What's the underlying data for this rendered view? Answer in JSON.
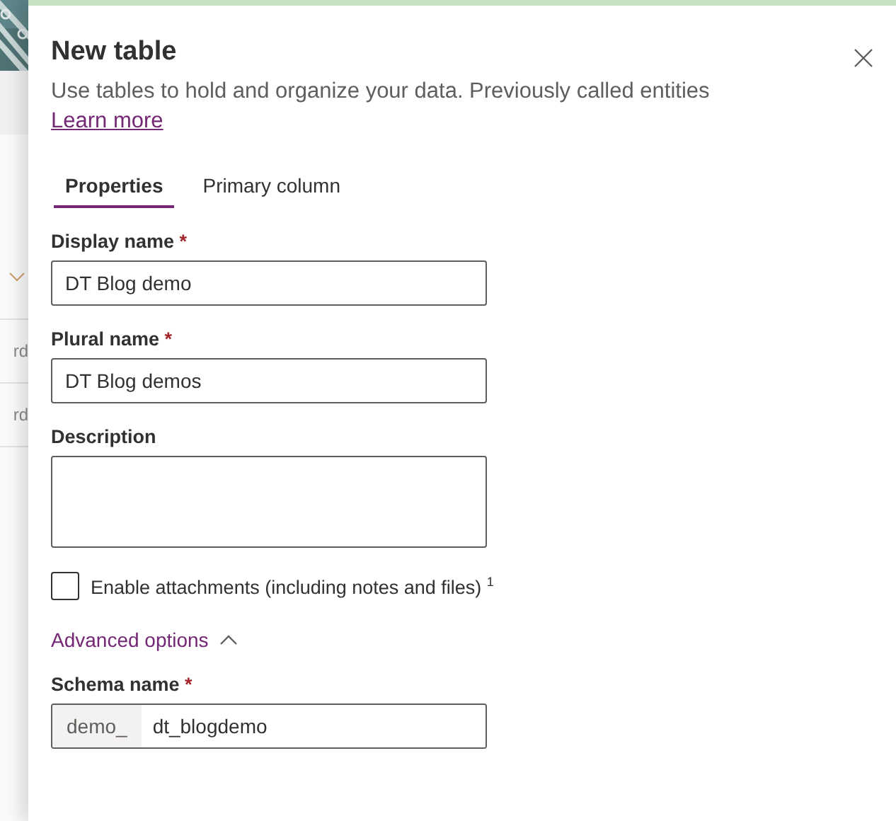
{
  "background": {
    "rows": [
      "rd",
      "rd"
    ]
  },
  "panel": {
    "title": "New table",
    "subtitle": "Use tables to hold and organize your data. Previously called entities",
    "link": "Learn more",
    "tabs": [
      {
        "label": "Properties",
        "selected": true
      },
      {
        "label": "Primary column",
        "selected": false
      }
    ],
    "fields": [
      {
        "kind": "text",
        "label": "Display name",
        "required_mark": "*",
        "value": "DT Blog demo"
      },
      {
        "kind": "text",
        "label": "Plural name",
        "required_mark": "*",
        "value": "DT Blog demos"
      },
      {
        "kind": "textarea",
        "label": "Description"
      }
    ],
    "checkbox": {
      "label": "Enable attachments (including notes and files) $^{1}$",
      "checked": false
    },
    "advanced": {
      "label": "Advanced options",
      "expanded": true
    },
    "schema": {
      "label": "Schema name",
      "required_mark": "*",
      "prefix": "demo_",
      "value": "dt_blogdemo"
    }
  }
}
